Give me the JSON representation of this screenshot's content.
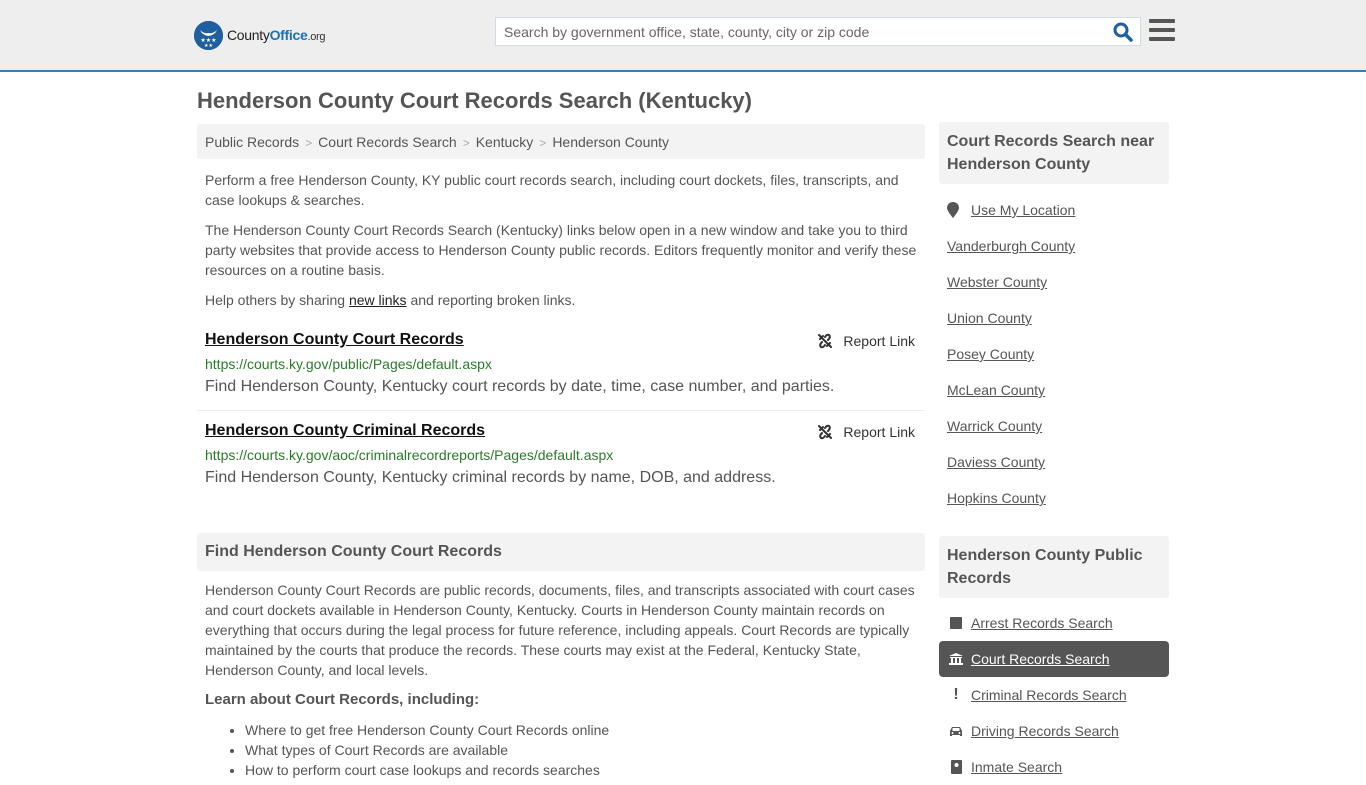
{
  "header": {
    "logo_text_main": "County",
    "logo_text_accent": "Office",
    "logo_text_tld": ".org",
    "search_placeholder": "Search by government office, state, county, city or zip code",
    "search_icon": "magnifier-icon",
    "menu_icon": "hamburger-icon",
    "accent_color": "#3a7cb0"
  },
  "page": {
    "title": "Henderson County Court Records Search (Kentucky)"
  },
  "breadcrumb": [
    {
      "label": "Public Records"
    },
    {
      "label": "Court Records Search"
    },
    {
      "label": "Kentucky"
    },
    {
      "label": "Henderson County"
    }
  ],
  "intro": {
    "p1": "Perform a free Henderson County, KY public court records search, including court dockets, files, transcripts, and case lookups & searches.",
    "p2": "The Henderson County Court Records Search (Kentucky) links below open in a new window and take you to third party websites that provide access to Henderson County public records. Editors frequently monitor and verify these resources on a routine basis.",
    "p3_before": "Help others by sharing ",
    "p3_link": "new links",
    "p3_after": " and reporting broken links."
  },
  "results": [
    {
      "title": "Henderson County Court Records",
      "url": "https://courts.ky.gov/public/Pages/default.aspx",
      "description": "Find Henderson County, Kentucky court records by date, time, case number, and parties.",
      "report_label": "Report Link"
    },
    {
      "title": "Henderson County Criminal Records",
      "url": "https://courts.ky.gov/aoc/criminalrecordreports/Pages/default.aspx",
      "description": "Find Henderson County, Kentucky criminal records by name, DOB, and address.",
      "report_label": "Report Link"
    }
  ],
  "find_section": {
    "heading": "Find Henderson County Court Records",
    "body": "Henderson County Court Records are public records, documents, files, and transcripts associated with court cases and court dockets available in Henderson County, Kentucky. Courts in Henderson County maintain records on everything that occurs during the legal process for future reference, including appeals. Court Records are typically maintained by the courts that produce the records. These courts may exist at the Federal, Kentucky State, Henderson County, and local levels.",
    "learn_heading": "Learn about Court Records, including:",
    "learn_items": [
      "Where to get free Henderson County Court Records online",
      "What types of Court Records are available",
      "How to perform court case lookups and records searches"
    ]
  },
  "sidebar": {
    "nearby_heading": "Court Records Search near Henderson County",
    "use_location": "Use My Location",
    "nearby": [
      "Vanderburgh County",
      "Webster County",
      "Union County",
      "Posey County",
      "McLean County",
      "Warrick County",
      "Daviess County",
      "Hopkins County"
    ],
    "public_heading": "Henderson County Public Records",
    "public_items": [
      {
        "label": "Arrest Records Search",
        "icon": "square-icon",
        "active": false
      },
      {
        "label": "Court Records Search",
        "icon": "courthouse-icon",
        "active": true
      },
      {
        "label": "Criminal Records Search",
        "icon": "exclamation-icon",
        "active": false
      },
      {
        "label": "Driving Records Search",
        "icon": "car-icon",
        "active": false
      },
      {
        "label": "Inmate Search",
        "icon": "inmate-icon",
        "active": false
      }
    ]
  }
}
